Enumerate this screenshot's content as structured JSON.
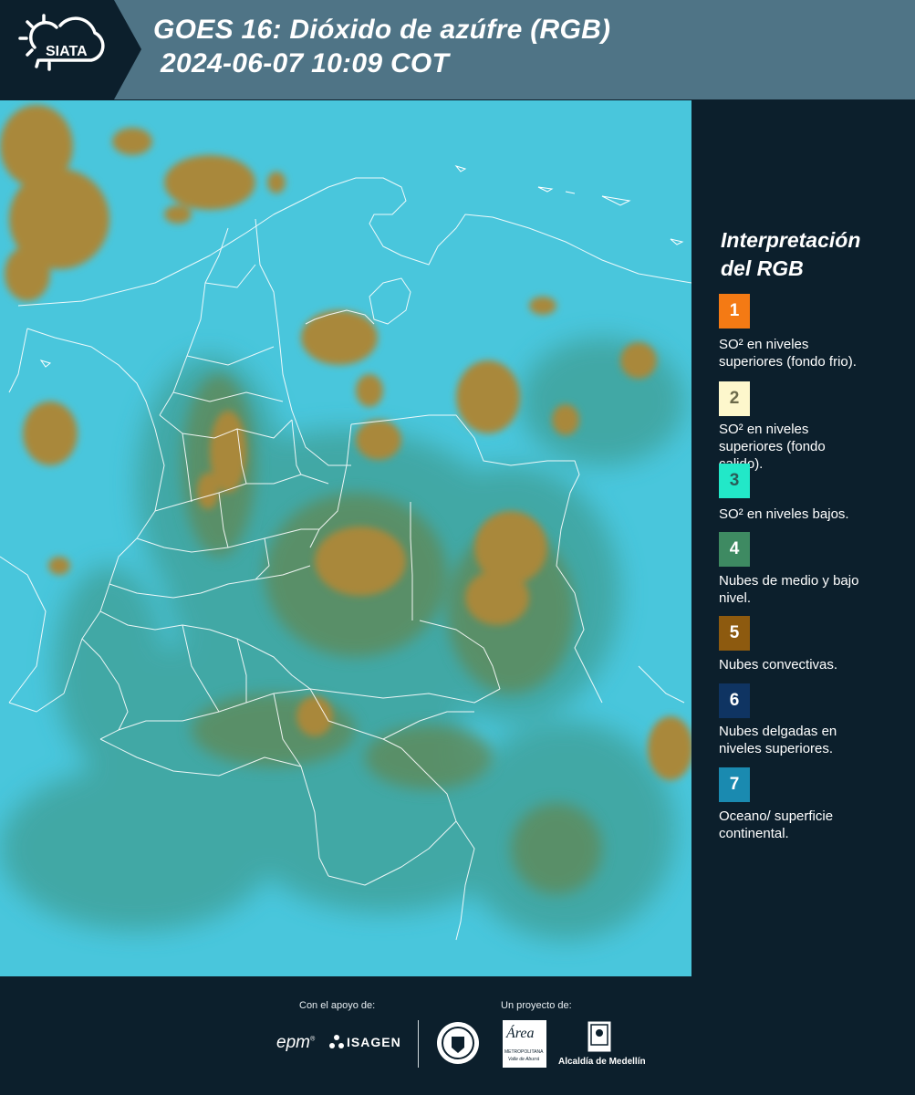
{
  "logo": {
    "text": "SIATA"
  },
  "header": {
    "title_line1": "GOES 16: Dióxido de azúfre (RGB)",
    "title_line2": "2024-06-07 10:09 COT"
  },
  "legend": {
    "title_line1": "Interpretación",
    "title_line2": "del RGB",
    "items": [
      {
        "number": "1",
        "color": "#f47a14",
        "lines": [
          "SO² en niveles",
          "superiores (fondo frio)."
        ]
      },
      {
        "number": "2",
        "color": "#fdf7cc",
        "lines": [
          "SO² en niveles",
          "superiores (fondo",
          "calido)."
        ]
      },
      {
        "number": "3",
        "color": "#22e8c8",
        "lines": [
          "SO² en niveles bajos."
        ]
      },
      {
        "number": "4",
        "color": "#3e8a62",
        "lines": [
          "Nubes de medio y bajo",
          "nivel."
        ]
      },
      {
        "number": "5",
        "color": "#8d5a0f",
        "lines": [
          "Nubes convectivas."
        ]
      },
      {
        "number": "6",
        "color": "#0f3462",
        "lines": [
          "Nubes delgadas en",
          "niveles superiores."
        ]
      },
      {
        "number": "7",
        "color": "#1a8ab0",
        "lines": [
          "Oceano/ superficie",
          "continental."
        ]
      }
    ]
  },
  "footer": {
    "support_label": "Con el apoyo de:",
    "project_label": "Un proyecto de:",
    "epm": "epm",
    "isagen": "ISAGEN",
    "area": "Área",
    "area_sub": "METROPOLITANA",
    "area_sub2": "Valle de Aburrá",
    "alcaldia": "Alcaldía de Medellín"
  }
}
